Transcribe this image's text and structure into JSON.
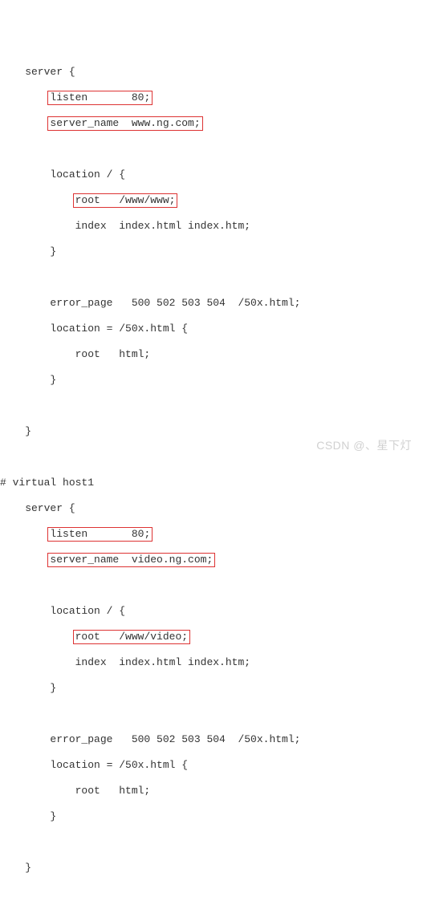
{
  "code": {
    "l1": "    server {",
    "l2a": "        ",
    "l2b": "listen       80;",
    "l3a": "        ",
    "l3b": "server_name  www.ng.com;",
    "l4": "",
    "l5": "        location / {",
    "l6a": "            ",
    "l6b": "root   /www/www;",
    "l7": "            index  index.html index.htm;",
    "l8": "        }",
    "l9": "",
    "l10": "        error_page   500 502 503 504  /50x.html;",
    "l11": "        location = /50x.html {",
    "l12": "            root   html;",
    "l13": "        }",
    "l14": "",
    "l15": "    }",
    "l16": "",
    "l17": "# virtual host1",
    "l18": "    server {",
    "l19a": "        ",
    "l19b": "listen       80;",
    "l20a": "        ",
    "l20b": "server_name  video.ng.com;",
    "l21": "",
    "l22": "        location / {",
    "l23a": "            ",
    "l23b": "root   /www/video;",
    "l24": "            index  index.html index.htm;",
    "l25": "        }",
    "l26": "",
    "l27": "        error_page   500 502 503 504  /50x.html;",
    "l28": "        location = /50x.html {",
    "l29": "            root   html;",
    "l30": "        }",
    "l31": "",
    "l32": "    }"
  },
  "watermark": "CSDN @、星下灯"
}
